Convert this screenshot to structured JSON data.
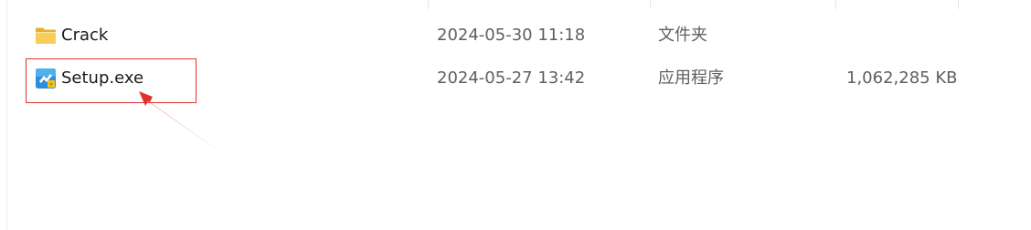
{
  "files": [
    {
      "name": "Crack",
      "date_modified": "2024-05-30 11:18",
      "type": "文件夹",
      "size": "",
      "icon": "folder-icon"
    },
    {
      "name": "Setup.exe",
      "date_modified": "2024-05-27 13:42",
      "type": "应用程序",
      "size": "1,062,285 KB",
      "icon": "installer-icon"
    }
  ],
  "annotation": {
    "color": "#e0322f",
    "highlight": "highlight-box",
    "pointer": "red-arrow"
  },
  "colors": {
    "folder": "#f4c44e",
    "installer_blue": "#2e8fd8",
    "installer_yellow": "#f5c518"
  }
}
